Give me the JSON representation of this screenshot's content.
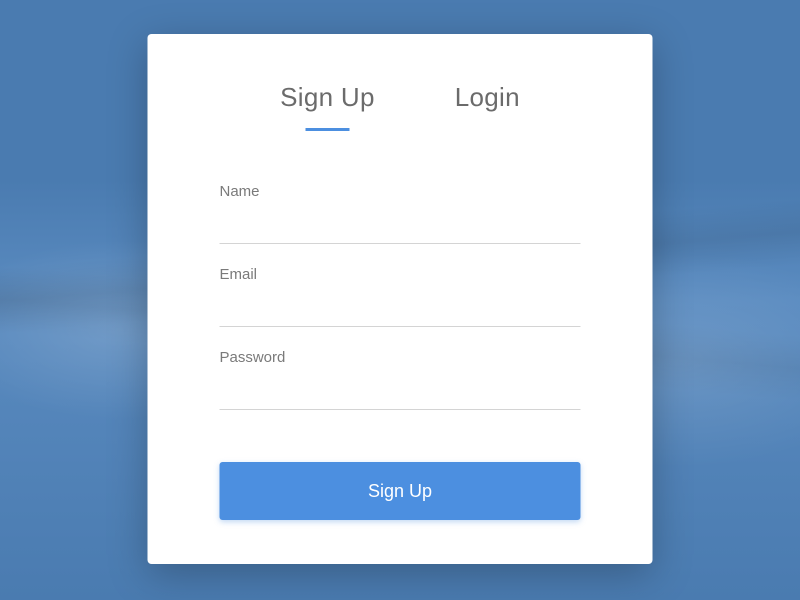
{
  "tabs": {
    "signup": "Sign Up",
    "login": "Login"
  },
  "form": {
    "name_label": "Name",
    "email_label": "Email",
    "password_label": "Password",
    "submit_label": "Sign Up"
  },
  "colors": {
    "accent": "#4c8fe0",
    "background": "#4a7bb0"
  }
}
